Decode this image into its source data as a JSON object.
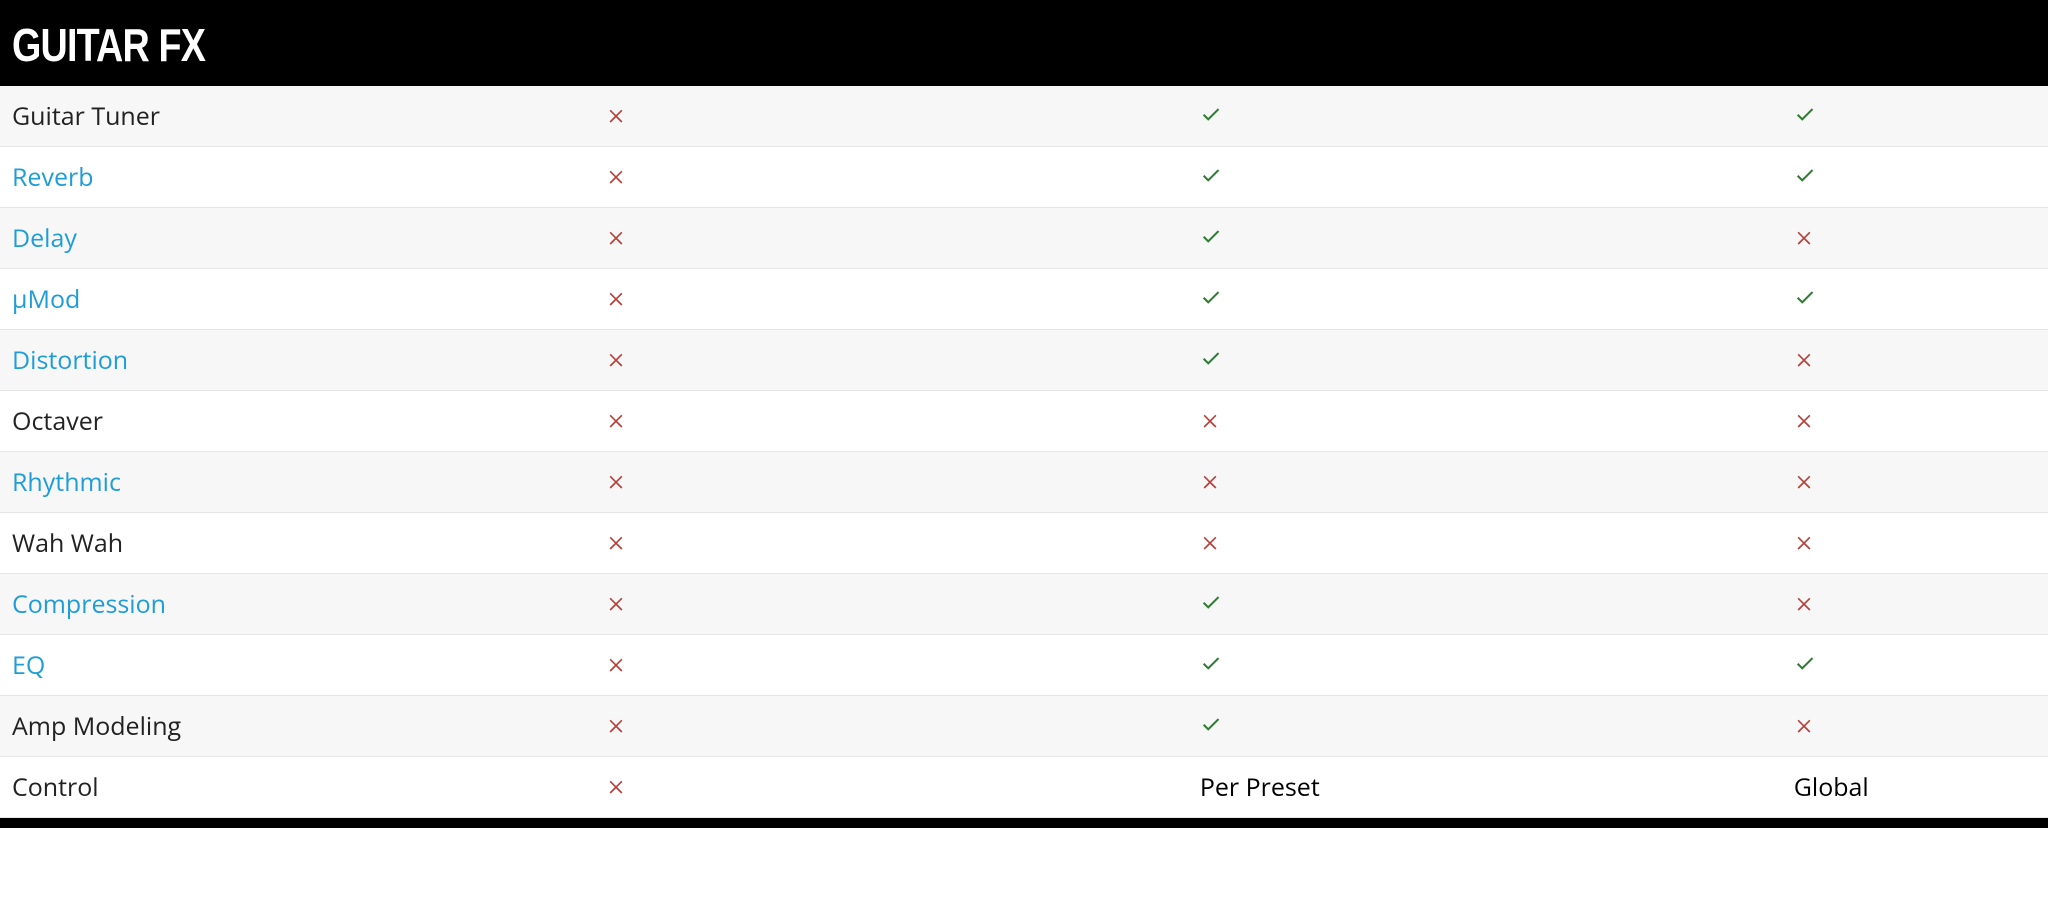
{
  "header": {
    "title": "GUITAR FX"
  },
  "colors": {
    "link": "#1E9DD8",
    "check": "#2E7D32",
    "cross": "#B7403A"
  },
  "icons": {
    "check": "check-icon",
    "cross": "cross-icon"
  },
  "rows": [
    {
      "label": "Guitar Tuner",
      "is_link": false,
      "c1": "cross",
      "c2": "check",
      "c3": "check"
    },
    {
      "label": "Reverb",
      "is_link": true,
      "c1": "cross",
      "c2": "check",
      "c3": "check"
    },
    {
      "label": "Delay",
      "is_link": true,
      "c1": "cross",
      "c2": "check",
      "c3": "cross"
    },
    {
      "label": "µMod",
      "is_link": true,
      "c1": "cross",
      "c2": "check",
      "c3": "check"
    },
    {
      "label": "Distortion",
      "is_link": true,
      "c1": "cross",
      "c2": "check",
      "c3": "cross"
    },
    {
      "label": "Octaver",
      "is_link": false,
      "c1": "cross",
      "c2": "cross",
      "c3": "cross"
    },
    {
      "label": "Rhythmic",
      "is_link": true,
      "c1": "cross",
      "c2": "cross",
      "c3": "cross"
    },
    {
      "label": "Wah Wah",
      "is_link": false,
      "c1": "cross",
      "c2": "cross",
      "c3": "cross"
    },
    {
      "label": "Compression",
      "is_link": true,
      "c1": "cross",
      "c2": "check",
      "c3": "cross"
    },
    {
      "label": "EQ",
      "is_link": true,
      "c1": "cross",
      "c2": "check",
      "c3": "check"
    },
    {
      "label": "Amp Modeling",
      "is_link": false,
      "c1": "cross",
      "c2": "check",
      "c3": "cross"
    },
    {
      "label": "Control",
      "is_link": false,
      "c1": "cross",
      "c2": "Per Preset",
      "c3": "Global"
    }
  ]
}
